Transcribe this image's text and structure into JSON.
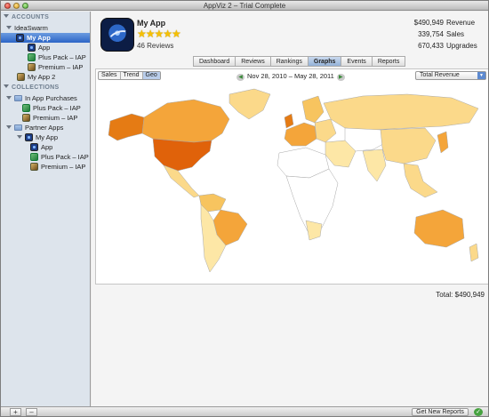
{
  "window": {
    "title": "AppViz 2 – Trial Complete"
  },
  "sidebar": {
    "accounts_header": "ACCOUNTS",
    "account_name": "IdeaSwarm",
    "accounts": [
      {
        "label": "My App"
      },
      {
        "label": "App"
      },
      {
        "label": "Plus Pack – IAP"
      },
      {
        "label": "Premium – IAP"
      },
      {
        "label": "My App 2"
      }
    ],
    "collections_header": "COLLECTIONS",
    "collections": [
      {
        "label": "In App Purchases"
      },
      {
        "label": "Plus Pack – IAP"
      },
      {
        "label": "Premium – IAP"
      },
      {
        "label": "Partner Apps"
      },
      {
        "label": "My App"
      },
      {
        "label": "App"
      },
      {
        "label": "Plus Pack – IAP"
      },
      {
        "label": "Premium – IAP"
      }
    ]
  },
  "app": {
    "name": "My App",
    "stars": "★★★★★",
    "reviews": "46 Reviews",
    "revenue_value": "$490,949",
    "revenue_label": "Revenue",
    "sales_value": "339,754",
    "sales_label": "Sales",
    "upgrades_value": "670,433",
    "upgrades_label": "Upgrades"
  },
  "tabs": [
    "Dashboard",
    "Reviews",
    "Rankings",
    "Graphs",
    "Events",
    "Reports"
  ],
  "active_tab": "Graphs",
  "graph": {
    "view_modes": [
      "Sales",
      "Trend",
      "Geo"
    ],
    "active_mode": "Geo",
    "date_range": "Nov 28, 2010 – May 28, 2011",
    "metric": "Total Revenue",
    "total": "Total: $490,949"
  },
  "colors": {
    "selection": "#2c65c6",
    "heat_high": "#e0620a",
    "heat_mid": "#f4a53a",
    "heat_low": "#fbd98a",
    "heat_faint": "#fff3c8"
  },
  "bottom": {
    "add": "+",
    "remove": "–",
    "get_reports": "Get New Reports",
    "status": "✓"
  }
}
